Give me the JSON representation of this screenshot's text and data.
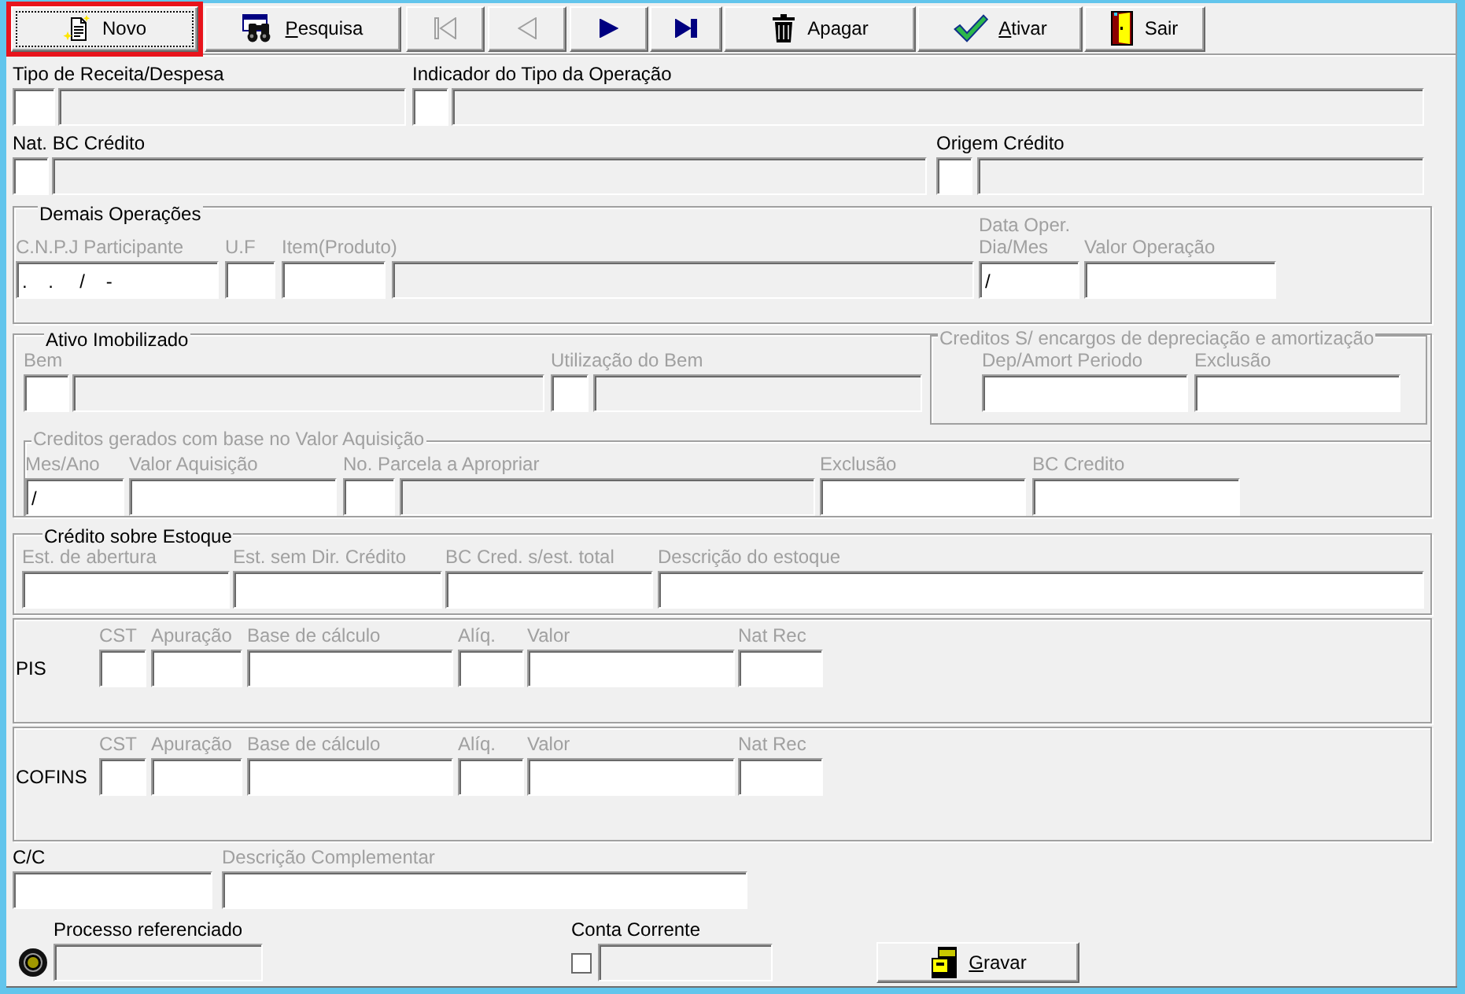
{
  "toolbar": [
    {
      "kind": "new",
      "label": "Novo",
      "disabled": false,
      "focused": true,
      "highlighted": true,
      "mnemonic": false
    },
    {
      "kind": "search",
      "label": "Pesquisa",
      "disabled": false,
      "focused": false,
      "highlighted": false,
      "mnemonic": true
    },
    {
      "kind": "first",
      "disabled": true,
      "focused": false,
      "highlighted": false
    },
    {
      "kind": "previous",
      "disabled": true,
      "focused": false,
      "highlighted": false
    },
    {
      "kind": "next",
      "disabled": false,
      "focused": false,
      "highlighted": false
    },
    {
      "kind": "last",
      "disabled": false,
      "focused": false,
      "highlighted": false
    },
    {
      "kind": "delete",
      "label": "Apagar",
      "disabled": false,
      "focused": false,
      "highlighted": false,
      "mnemonic": false
    },
    {
      "kind": "activate",
      "label": "Ativar",
      "disabled": false,
      "focused": false,
      "highlighted": false,
      "mnemonic": true
    },
    {
      "kind": "exit",
      "label": "Sair",
      "disabled": false,
      "focused": false,
      "highlighted": false,
      "mnemonic": false
    }
  ],
  "row_1": [
    {
      "label": "Tipo de Receita/Despesa",
      "disabled": false,
      "inputs": [
        {
          "readonly": false
        },
        {
          "readonly": true
        }
      ]
    },
    {
      "label": "Indicador do Tipo da Operação",
      "disabled": false,
      "inputs": [
        {
          "readonly": false
        },
        {
          "readonly": true
        }
      ]
    }
  ],
  "row_2": [
    {
      "label": "Nat. BC Crédito",
      "disabled": false,
      "inputs": [
        {
          "readonly": false
        },
        {
          "readonly": true
        }
      ]
    },
    {
      "label": "Origem Crédito",
      "disabled": false,
      "inputs": [
        {
          "readonly": false
        },
        {
          "readonly": true
        }
      ]
    }
  ],
  "demais_operacoes": {
    "title": "Demais Operações",
    "disabled": false,
    "fields": [
      {
        "label": "C.N.P.J Participante",
        "disabled": true,
        "inputs": [
          {
            "readonly": false,
            "value": ".    .     /    -"
          }
        ]
      },
      {
        "label": "U.F",
        "disabled": true,
        "inputs": [
          {
            "readonly": false
          }
        ]
      },
      {
        "label": "Item(Produto)",
        "disabled": true,
        "inputs": [
          {
            "readonly": false
          },
          {
            "readonly": true
          }
        ]
      },
      {
        "label": "Data Oper.\nDia/Mes",
        "disabled": true,
        "inputs": [
          {
            "readonly": false,
            "value": "/"
          }
        ]
      },
      {
        "label": "Valor Operação",
        "disabled": true,
        "inputs": [
          {
            "readonly": false
          }
        ]
      }
    ]
  },
  "ativo_imobilizado": {
    "title": "Ativo Imobilizado",
    "disabled": false,
    "fields": [
      {
        "label": "Bem",
        "disabled": true,
        "inputs": [
          {
            "readonly": false
          },
          {
            "readonly": true
          }
        ]
      },
      {
        "label": "Utilização do Bem",
        "disabled": true,
        "inputs": [
          {
            "readonly": false
          },
          {
            "readonly": true
          }
        ]
      }
    ],
    "depreciacao": {
      "title": "Creditos S/ encargos de depreciação e amortização",
      "disabled": true,
      "fields": [
        {
          "label": "Dep/Amort Periodo",
          "disabled": true,
          "inputs": [
            {
              "readonly": false
            }
          ]
        },
        {
          "label": "Exclusão",
          "disabled": true,
          "inputs": [
            {
              "readonly": false
            }
          ]
        }
      ]
    },
    "valor_aquisicao": {
      "title": "Creditos gerados com base no Valor Aquisição",
      "disabled": true,
      "fields": [
        {
          "label": "Mes/Ano",
          "disabled": true,
          "inputs": [
            {
              "readonly": false,
              "value": "/"
            }
          ]
        },
        {
          "label": "Valor Aquisição",
          "disabled": true,
          "inputs": [
            {
              "readonly": false
            }
          ]
        },
        {
          "label": "No. Parcela a Apropriar",
          "disabled": true,
          "inputs": [
            {
              "readonly": false
            },
            {
              "readonly": true
            }
          ]
        },
        {
          "label": "Exclusão",
          "disabled": true,
          "inputs": [
            {
              "readonly": false
            }
          ]
        },
        {
          "label": "BC Credito",
          "disabled": true,
          "inputs": [
            {
              "readonly": false
            }
          ]
        }
      ]
    }
  },
  "credito_estoque": {
    "title": "Crédito sobre Estoque",
    "disabled": false,
    "fields": [
      {
        "label": "Est. de abertura",
        "disabled": true,
        "inputs": [
          {
            "readonly": false
          }
        ]
      },
      {
        "label": "Est. sem Dir. Crédito",
        "disabled": true,
        "inputs": [
          {
            "readonly": false
          }
        ]
      },
      {
        "label": "BC Cred. s/est. total",
        "disabled": true,
        "inputs": [
          {
            "readonly": false
          }
        ]
      },
      {
        "label": "Descrição do estoque",
        "disabled": true,
        "inputs": [
          {
            "readonly": false
          }
        ]
      }
    ]
  },
  "taxes": [
    {
      "label": "PIS",
      "fields": [
        {
          "label": "CST",
          "disabled": true,
          "inputs": [
            {
              "readonly": false
            }
          ]
        },
        {
          "label": "Apuração",
          "disabled": true,
          "inputs": [
            {
              "readonly": false
            }
          ]
        },
        {
          "label": "Base de cálculo",
          "disabled": true,
          "inputs": [
            {
              "readonly": false
            }
          ]
        },
        {
          "label": "Alíq.",
          "disabled": true,
          "inputs": [
            {
              "readonly": false
            }
          ]
        },
        {
          "label": "Valor",
          "disabled": true,
          "inputs": [
            {
              "readonly": false
            }
          ]
        },
        {
          "label": "Nat Rec",
          "disabled": true,
          "inputs": [
            {
              "readonly": false
            }
          ]
        }
      ]
    },
    {
      "label": "COFINS",
      "fields": [
        {
          "label": "CST",
          "disabled": true,
          "inputs": [
            {
              "readonly": false
            }
          ]
        },
        {
          "label": "Apuração",
          "disabled": true,
          "inputs": [
            {
              "readonly": false
            }
          ]
        },
        {
          "label": "Base de cálculo",
          "disabled": true,
          "inputs": [
            {
              "readonly": false
            }
          ]
        },
        {
          "label": "Alíq.",
          "disabled": true,
          "inputs": [
            {
              "readonly": false
            }
          ]
        },
        {
          "label": "Valor",
          "disabled": true,
          "inputs": [
            {
              "readonly": false
            }
          ]
        },
        {
          "label": "Nat Rec",
          "disabled": true,
          "inputs": [
            {
              "readonly": false
            }
          ]
        }
      ]
    }
  ],
  "complemento": [
    {
      "label": "C/C",
      "disabled": false,
      "inputs": [
        {
          "readonly": false
        }
      ]
    },
    {
      "label": "Descrição Complementar",
      "disabled": true,
      "inputs": [
        {
          "readonly": false
        }
      ]
    }
  ],
  "processo": {
    "label": "Processo referenciado",
    "disabled": false,
    "selected": true,
    "inputs": [
      {
        "readonly": true
      }
    ]
  },
  "conta_corrente": {
    "label": "Conta Corrente",
    "disabled": false,
    "checked": false,
    "inputs": [
      {
        "readonly": true
      }
    ]
  },
  "save_button": {
    "label": "Gravar",
    "mnemonic": true
  }
}
